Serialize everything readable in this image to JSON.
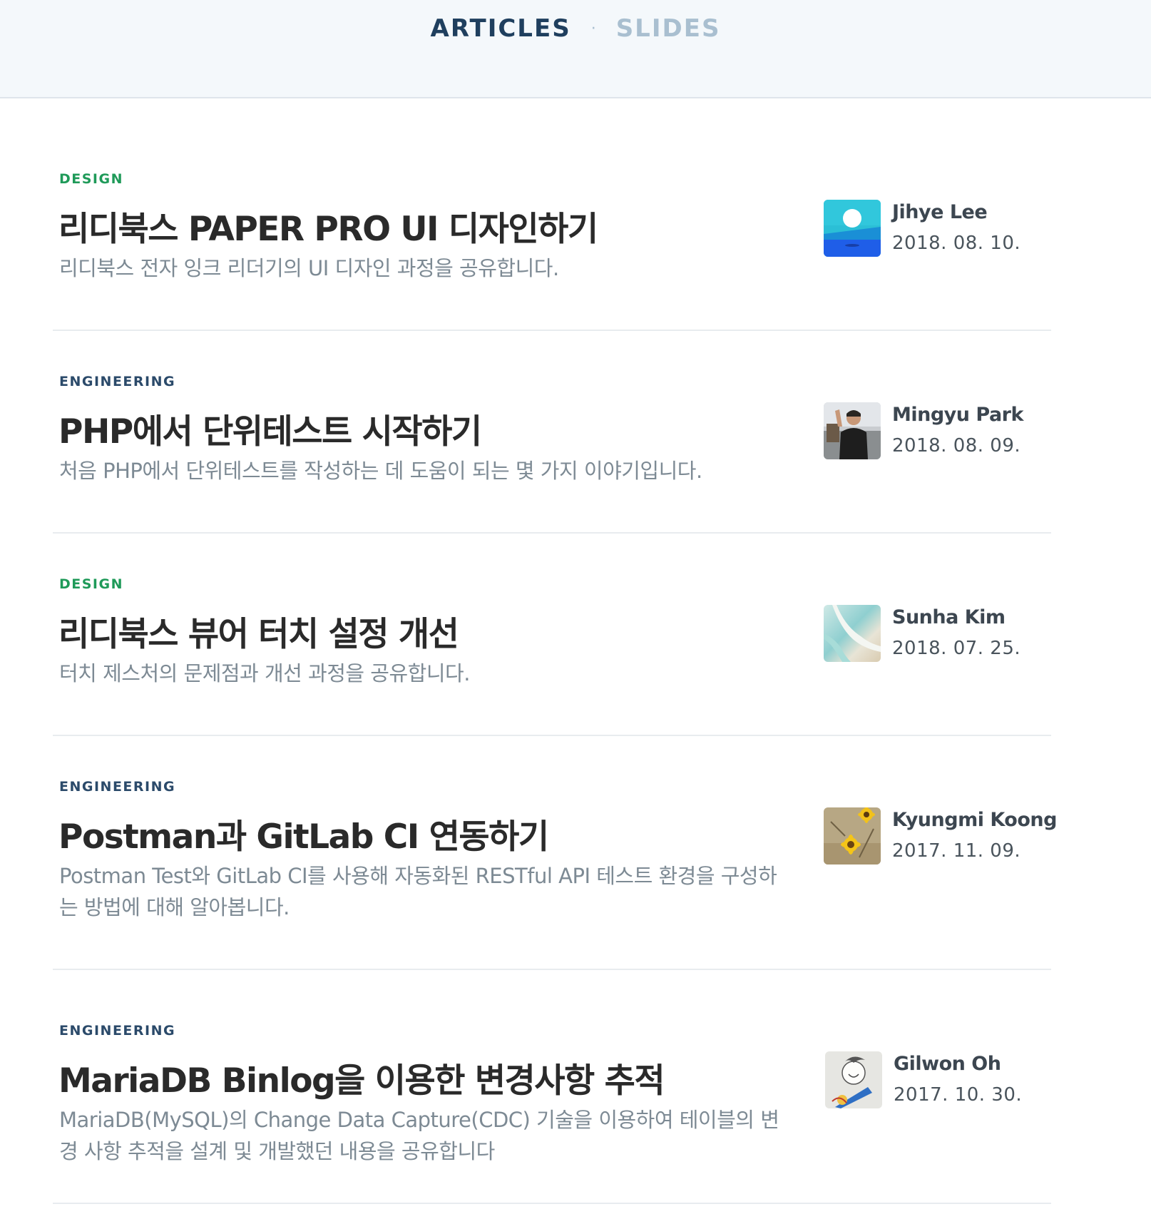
{
  "nav": {
    "articles_label": "ARTICLES",
    "separator": "·",
    "slides_label": "SLIDES"
  },
  "articles": [
    {
      "category": "DESIGN",
      "title": "리디북스 PAPER PRO UI 디자인하기",
      "description": "리디북스 전자 잉크 리더기의 UI 디자인 과정을 공유합니다.",
      "author": "Jihye Lee",
      "date": "2018. 08. 10.",
      "avatar_icon": "landscape-illustration-avatar"
    },
    {
      "category": "ENGINEERING",
      "title": "PHP에서 단위테스트 시작하기",
      "description": "처음 PHP에서 단위테스트를 작성하는 데 도움이 되는 몇 가지 이야기입니다.",
      "author": "Mingyu Park",
      "date": "2018. 08. 09.",
      "avatar_icon": "person-photo-avatar"
    },
    {
      "category": "DESIGN",
      "title": "리디북스 뷰어 터치 설정 개선",
      "description": "터치 제스처의 문제점과 개선 과정을 공유합니다.",
      "author": "Sunha Kim",
      "date": "2018. 07. 25.",
      "avatar_icon": "beach-photo-avatar"
    },
    {
      "category": "ENGINEERING",
      "title": "Postman과 GitLab CI 연동하기",
      "description": "Postman Test와 GitLab CI를 사용해 자동화된 RESTful API 테스트 환경을 구성하는 방법에 대해 알아봅니다.",
      "author": "Kyungmi Koong",
      "date": "2017. 11. 09.",
      "avatar_icon": "flower-photo-avatar"
    },
    {
      "category": "ENGINEERING",
      "title": "MariaDB Binlog을 이용한 변경사항 추적",
      "description": "MariaDB(MySQL)의 Change Data Capture(CDC) 기술을 이용하여 테이블의 변경 사항 추적을 설계 및 개발했던 내용을 공유합니다",
      "author": "Gilwon Oh",
      "date": "2017. 10. 30.",
      "avatar_icon": "cartoon-sketch-avatar"
    }
  ],
  "colors": {
    "nav_bg": "#f4f8fb",
    "nav_active": "#1f3f5e",
    "nav_inactive": "#a9bfd0",
    "category_design": "#1f9a59",
    "category_engineering": "#2b4a6a",
    "title": "#2a2a2a",
    "description": "#7d8a94"
  }
}
